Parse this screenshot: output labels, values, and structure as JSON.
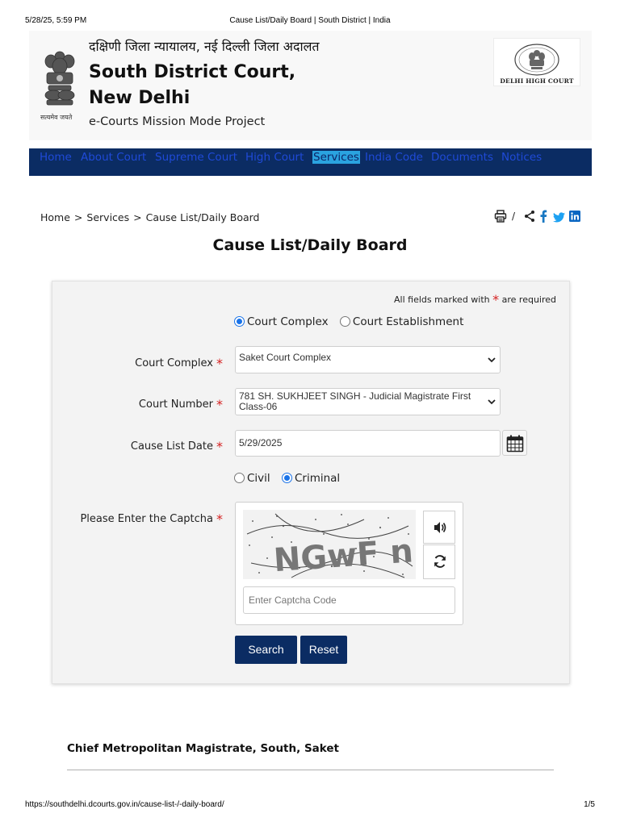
{
  "print_header": {
    "timestamp": "5/28/25, 5:59 PM",
    "page_title": "Cause List/Daily Board | South District | India"
  },
  "print_footer": {
    "url": "https://southdelhi.dcourts.gov.in/cause-list-/-daily-board/",
    "page": "1/5"
  },
  "header": {
    "hindi_title": "दक्षिणी जिला न्यायालय, नई दिल्ली जिला अदालत",
    "court_name": "South District Court, New Delhi",
    "project": "e-Courts Mission Mode Project",
    "emblem_motto": "सत्यमेव जयते",
    "emblem_icon": "national-emblem-icon",
    "high_court_logo_text": "DELHI HIGH COURT"
  },
  "nav": {
    "items": [
      {
        "label": "Home"
      },
      {
        "label": "About Court"
      },
      {
        "label": "Supreme Court"
      },
      {
        "label": "High Court"
      },
      {
        "label": "Services",
        "active": true
      },
      {
        "label": "India Code"
      },
      {
        "label": "Documents"
      },
      {
        "label": "Notices"
      }
    ],
    "bg_color": "#0b2c63",
    "active_bg": "#2aa3e0"
  },
  "breadcrumb": {
    "items": [
      "Home",
      "Services",
      "Cause List/Daily Board"
    ],
    "separator": ">"
  },
  "share_tools": {
    "icons": [
      "print-icon",
      "share-icon",
      "facebook-icon",
      "twitter-icon",
      "linkedin-icon"
    ],
    "separator": "/"
  },
  "page_title": "Cause List/Daily Board",
  "form": {
    "required_note_prefix": "All fields marked with",
    "required_note_suffix": "are required",
    "required_marker": "*",
    "search_by": {
      "options": [
        "Court Complex",
        "Court Establishment"
      ],
      "selected": "Court Complex"
    },
    "court_complex": {
      "label": "Court Complex",
      "value": "Saket Court Complex"
    },
    "court_number": {
      "label": "Court Number",
      "value": "781 SH. SUKHJEET SINGH - Judicial Magistrate First Class-06"
    },
    "cause_list_date": {
      "label": "Cause List Date",
      "value": "5/29/2025",
      "button_icon": "calendar-icon"
    },
    "case_type": {
      "options": [
        "Civil",
        "Criminal"
      ],
      "selected": "Criminal"
    },
    "captcha": {
      "label": "Please Enter the Captcha",
      "image_text": "NGwF n",
      "audio_icon": "volume-icon",
      "refresh_icon": "refresh-icon",
      "placeholder": "Enter Captcha Code"
    },
    "search_label": "Search",
    "reset_label": "Reset",
    "button_color": "#0b2c63"
  },
  "section": {
    "title": "Chief Metropolitan Magistrate, South, Saket"
  }
}
